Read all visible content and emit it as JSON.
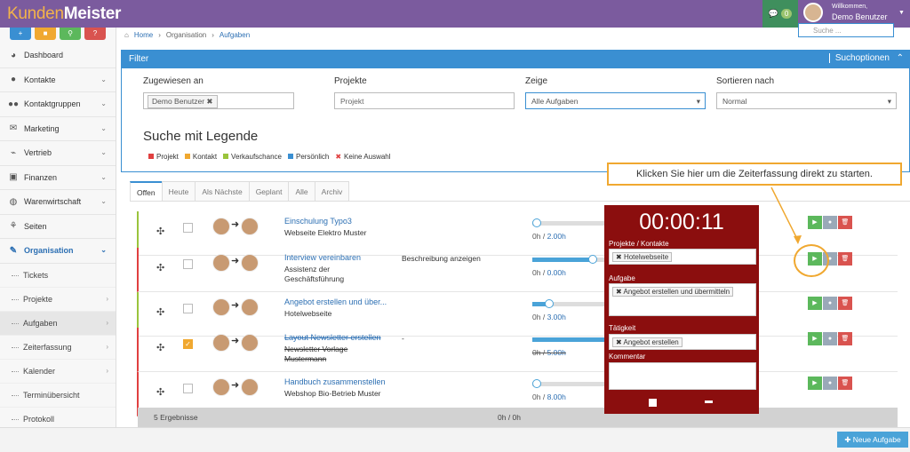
{
  "app": {
    "logo_a": "Kunden",
    "logo_b": "Meister"
  },
  "header": {
    "chat_badge": "0",
    "welcome": "Willkommen,",
    "user": "Demo Benutzer"
  },
  "search": {
    "placeholder": "Suche ..."
  },
  "breadcrumb": {
    "home": "Home",
    "org": "Organisation",
    "current": "Aufgaben"
  },
  "sidebar": {
    "items": [
      {
        "label": "Dashboard"
      },
      {
        "label": "Kontakte"
      },
      {
        "label": "Kontaktgruppen"
      },
      {
        "label": "Marketing"
      },
      {
        "label": "Vertrieb"
      },
      {
        "label": "Finanzen"
      },
      {
        "label": "Warenwirtschaft"
      },
      {
        "label": "Seiten"
      },
      {
        "label": "Organisation"
      }
    ],
    "subitems": [
      {
        "label": "Tickets"
      },
      {
        "label": "Projekte"
      },
      {
        "label": "Aufgaben"
      },
      {
        "label": "Zeiterfassung"
      },
      {
        "label": "Kalender"
      },
      {
        "label": "Terminübersicht"
      },
      {
        "label": "Protokoll"
      }
    ]
  },
  "filter": {
    "title": "Filter",
    "options": "Suchoptionen",
    "assigned_label": "Zugewiesen an",
    "assigned_value": "Demo Benutzer",
    "projects_label": "Projekte",
    "projects_placeholder": "Projekt",
    "show_label": "Zeige",
    "show_value": "Alle Aufgaben",
    "sort_label": "Sortieren nach",
    "sort_value": "Normal",
    "legend_title": "Suche mit Legende",
    "legend": [
      {
        "label": "Projekt",
        "color": "#e04040"
      },
      {
        "label": "Kontakt",
        "color": "#f0a830"
      },
      {
        "label": "Verkaufschance",
        "color": "#9ac43c"
      },
      {
        "label": "Persönlich",
        "color": "#3a8fd2"
      },
      {
        "label": "Keine Auswahl",
        "color": "#e04040"
      }
    ]
  },
  "tabs": [
    "Offen",
    "Heute",
    "Als Nächste",
    "Geplant",
    "Alle",
    "Archiv"
  ],
  "tasks": [
    {
      "title": "Einschulung Typo3",
      "sub": "Webseite Elektro Muster",
      "desc": "",
      "time_a": "0h",
      "time_b": "2.00h",
      "progress": 0.0,
      "border": "#9ac43c"
    },
    {
      "title": "Interview vereinbaren",
      "sub": "Assistenz der Geschäftsführung",
      "desc": "Beschreibung anzeigen",
      "time_a": "0h",
      "time_b": "0.00h",
      "progress": 0.77,
      "border": "#e04040"
    },
    {
      "title": "Angebot erstellen und über...",
      "sub": "Hotelwebseite",
      "desc": "",
      "time_a": "0h",
      "time_b": "3.00h",
      "progress": 0.22,
      "border": "#9ac43c"
    },
    {
      "title": "Layout Newsletter erstellen",
      "sub": "Newsletter Vorlage Mustermann",
      "desc": "-",
      "time_a": "0h",
      "time_b": "5.00h",
      "progress": 1.0,
      "border": "#e04040"
    },
    {
      "title": "Handbuch zusammenstellen",
      "sub": "Webshop Bio-Betrieb Muster",
      "desc": "",
      "time_a": "0h",
      "time_b": "8.00h",
      "progress": 0.0,
      "border": "#e04040"
    }
  ],
  "footer": {
    "count": "5 Ergebnisse",
    "total": "0h / 0h"
  },
  "timer": {
    "clock": "00:00:11",
    "projects_label": "Projekte / Kontakte",
    "project": "Hotelwebseite",
    "task_label": "Aufgabe",
    "task": "Angebot erstellen und übermitteln",
    "activity_label": "Tätigkeit",
    "activity": "Angebot erstellen",
    "comment_label": "Kommentar"
  },
  "callout": {
    "text": "Klicken Sie hier um die Zeiterfassung direkt zu starten."
  },
  "new_task": "Neue Aufgabe"
}
